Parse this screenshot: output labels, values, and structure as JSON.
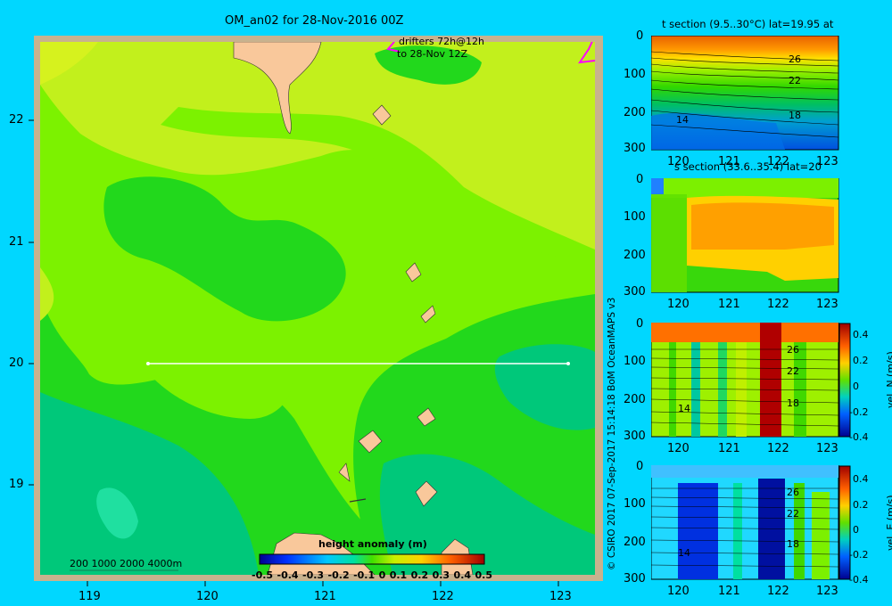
{
  "main_map": {
    "title": "OM_an02 for 28-Nov-2016 00Z",
    "drifters_line1": "drifters 72h@12h",
    "drifters_line2": "to 28-Nov 12Z",
    "x_ticks": [
      "119",
      "120",
      "121",
      "122",
      "123"
    ],
    "y_ticks": [
      "22",
      "21",
      "20",
      "19"
    ],
    "depth_legend": "200  1000  2000  4000m",
    "colorbar_label": "height anomaly  (m)",
    "colorbar_ticks": [
      "-0.5",
      "-0.4",
      "-0.3",
      "-0.2",
      "-0.1",
      "0",
      "0.1",
      "0.2",
      "0.3",
      "0.4",
      "0.5"
    ],
    "section_line": {
      "lat": 20,
      "lon_start": 119.5,
      "lon_end": 123.2
    },
    "colors": {
      "land": "#f9c89b",
      "frame": "#c8b28e",
      "light_green": "#c2f01c",
      "green": "#7cf200",
      "mid_green": "#22d81c",
      "teal": "#00c87a"
    }
  },
  "panels": [
    {
      "id": "t-section",
      "title": "t section (9.5..30°C) lat=19.95 at",
      "y_ticks": [
        "0",
        "100",
        "200",
        "300"
      ],
      "x_ticks": [
        "120",
        "121",
        "122",
        "123"
      ],
      "contour_labels": [
        "26",
        "22",
        "18",
        "14"
      ],
      "colorbar": null
    },
    {
      "id": "s-section",
      "title": "s section (33.6..35.4) lat=20",
      "y_ticks": [
        "0",
        "100",
        "200",
        "300"
      ],
      "x_ticks": [
        "120",
        "121",
        "122",
        "123"
      ],
      "contour_labels": [],
      "colorbar": null
    },
    {
      "id": "vel-n",
      "title": "",
      "y_ticks": [
        "0",
        "100",
        "200",
        "300"
      ],
      "x_ticks": [
        "120",
        "121",
        "122",
        "123"
      ],
      "contour_labels": [
        "26",
        "22",
        "18",
        "14"
      ],
      "colorbar": {
        "label": "vel. N (m/s)",
        "ticks": [
          "0.4",
          "0.2",
          "0",
          "-0.2",
          "-0.4"
        ]
      }
    },
    {
      "id": "vel-e",
      "title": "",
      "y_ticks": [
        "0",
        "100",
        "200",
        "300"
      ],
      "x_ticks": [
        "120",
        "121",
        "122",
        "123"
      ],
      "contour_labels": [
        "26",
        "22",
        "18",
        "14"
      ],
      "colorbar": {
        "label": "vel. E (m/s)",
        "ticks": [
          "0.4",
          "0.2",
          "0",
          "-0.2",
          "-0.4"
        ]
      }
    }
  ],
  "chart_data": [
    {
      "type": "heatmap",
      "title": "OM_an02 for 28-Nov-2016 00Z",
      "x_ticks": [
        119,
        120,
        121,
        122,
        123
      ],
      "y_ticks": [
        22,
        21,
        20,
        19
      ],
      "xlim": [
        118.5,
        123.5
      ],
      "ylim": [
        18.3,
        22.7
      ],
      "colorbar": {
        "label": "height anomaly  (m)",
        "range": [
          -0.5,
          0.5
        ]
      }
    },
    {
      "type": "heatmap",
      "title": "t section (9.5..30°C) lat=19.95 at",
      "ylim": [
        300,
        0
      ],
      "xlim": [
        119.5,
        123.2
      ],
      "contour_labels": [
        26,
        22,
        18,
        14
      ]
    },
    {
      "type": "heatmap",
      "title": "s section (33.6..35.4) lat=20",
      "ylim": [
        300,
        0
      ],
      "xlim": [
        119.5,
        123.2
      ]
    },
    {
      "type": "heatmap",
      "title": "",
      "colorbar": {
        "label": "vel. N (m/s)",
        "range": [
          -0.4,
          0.4
        ]
      },
      "ylim": [
        300,
        0
      ],
      "xlim": [
        119.5,
        123.2
      ]
    },
    {
      "type": "heatmap",
      "title": "",
      "colorbar": {
        "label": "vel. E (m/s)",
        "range": [
          -0.4,
          0.4
        ]
      },
      "ylim": [
        300,
        0
      ],
      "xlim": [
        119.5,
        123.2
      ]
    }
  ],
  "credit": "© CSIRO 2017   07-Sep-2017 15:14:18 BoM OceanMAPS v3"
}
